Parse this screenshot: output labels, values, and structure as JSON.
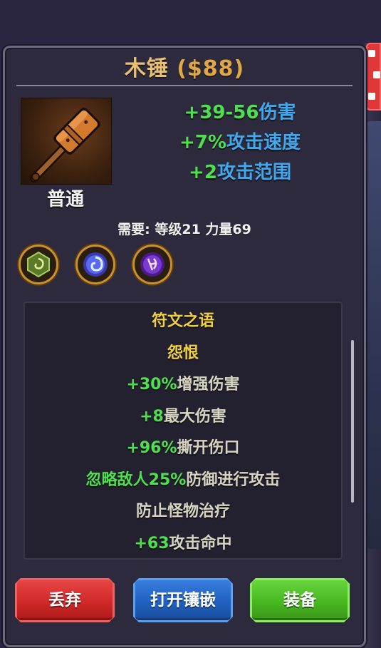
{
  "item": {
    "name": "木锤",
    "price": "($88)",
    "rarity": "普通",
    "icon": "wooden-hammer-icon"
  },
  "stats": [
    {
      "value": "+39-56",
      "label": "伤害"
    },
    {
      "value": "+7%",
      "label": "攻击速度"
    },
    {
      "value": "+2",
      "label": "攻击范围"
    }
  ],
  "requirement": "需要: 等级21 力量69",
  "sockets": [
    {
      "icon": "green-rune-icon",
      "color": "#8fbf4a"
    },
    {
      "icon": "blue-rune-icon",
      "color": "#6a7af0"
    },
    {
      "icon": "purple-rune-icon",
      "color": "#9a5af0"
    }
  ],
  "runeword": {
    "title": "符文之语",
    "name": "怨恨",
    "lines": [
      {
        "value": "+30%",
        "text": "增强伤害"
      },
      {
        "value": "+8",
        "text": "最大伤害"
      },
      {
        "value": "+96%",
        "text": "撕开伤口"
      },
      {
        "value": "忽略敌人25%",
        "text": "防御进行攻击"
      },
      {
        "value": "",
        "text": "防止怪物治疗"
      },
      {
        "value": "+63",
        "text": "攻击命中"
      }
    ]
  },
  "buttons": {
    "discard": "丢弃",
    "open_socket": "打开镶嵌",
    "equip": "装备"
  },
  "colors": {
    "stat_value": "#4ee04e",
    "stat_label": "#3fa8f0",
    "gold": "#e8c070",
    "runeword": "#f0d040"
  }
}
